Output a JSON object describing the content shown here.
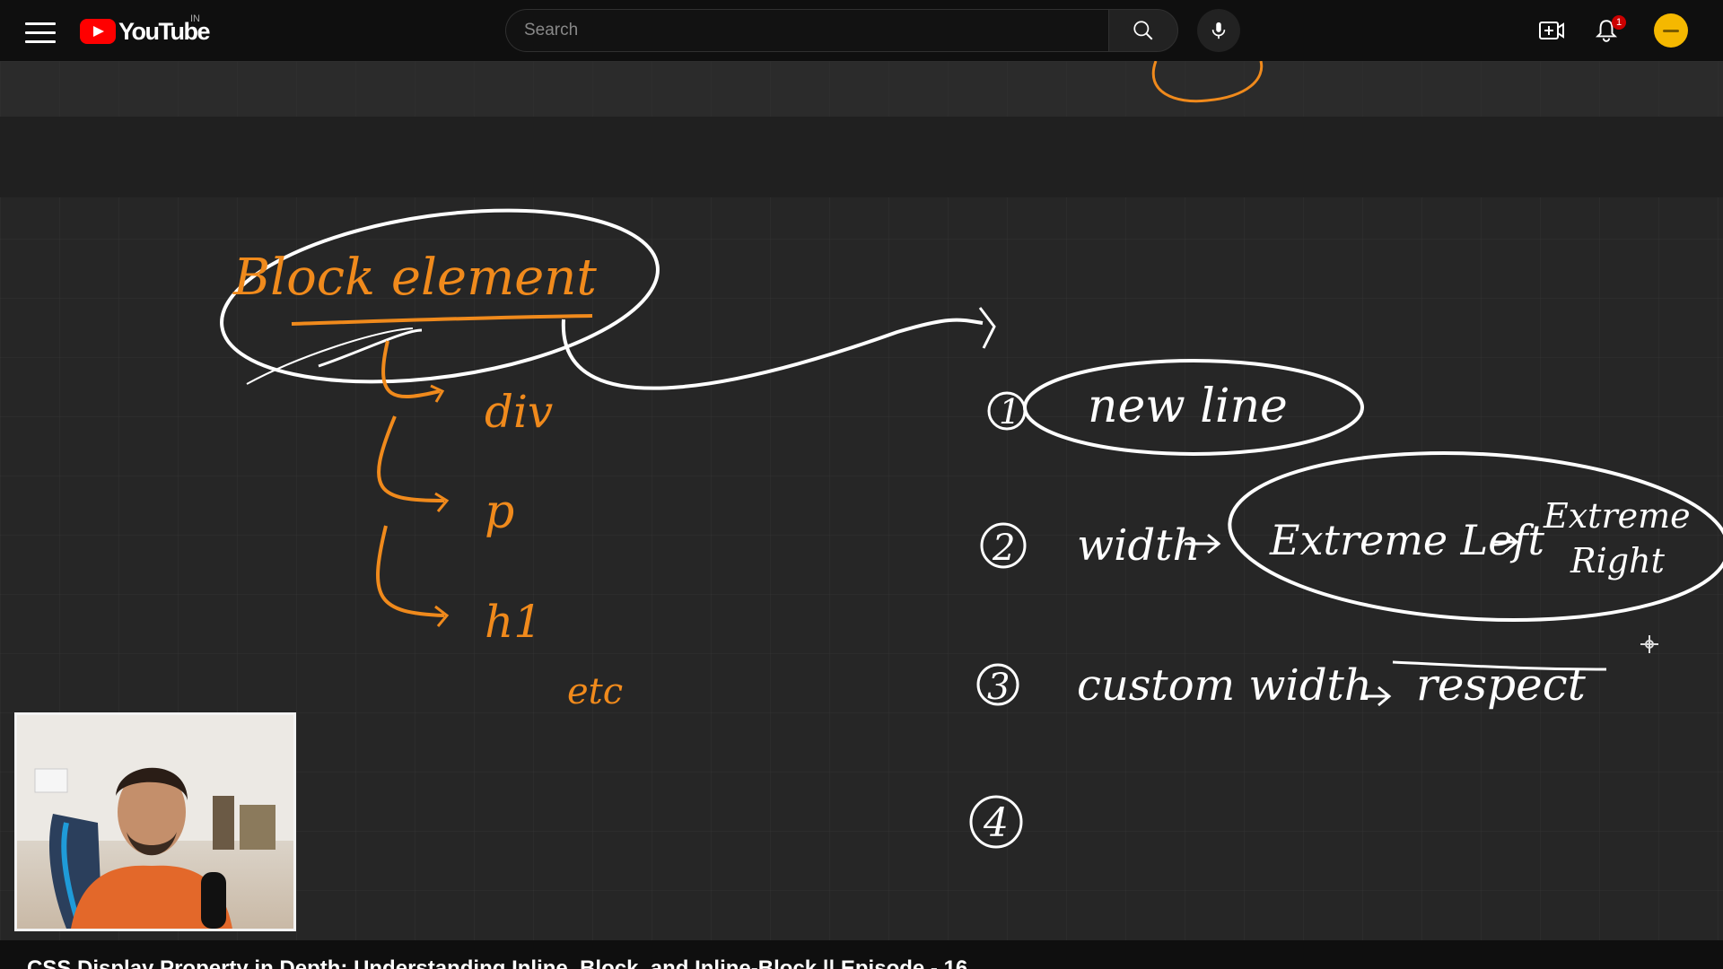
{
  "header": {
    "logo_text": "YouTube",
    "country_code": "IN",
    "search_placeholder": "Search",
    "notification_count": "1",
    "icons": [
      "menu-icon",
      "youtube-logo-icon",
      "search-icon",
      "mic-icon",
      "create-video-icon",
      "bell-icon",
      "avatar"
    ]
  },
  "whiteboard": {
    "heading": "Block element",
    "examples": [
      "div",
      "p",
      "h1",
      "etc"
    ],
    "points": [
      {
        "number": "1",
        "text": "new line"
      },
      {
        "number": "2",
        "text": "width",
        "detail_left": "Extreme Left",
        "detail_right_1": "Extreme",
        "detail_right_2": "Right"
      },
      {
        "number": "3",
        "text": "custom width",
        "detail": "respect"
      },
      {
        "number": "4",
        "text": ""
      }
    ],
    "colors": {
      "orange_ink": "#f08a1c",
      "white_ink": "#ffffff",
      "board": "#262626"
    }
  },
  "video": {
    "title": "CSS Display Property in Depth: Understanding Inline, Block, and Inline-Block || Episode - 16"
  }
}
